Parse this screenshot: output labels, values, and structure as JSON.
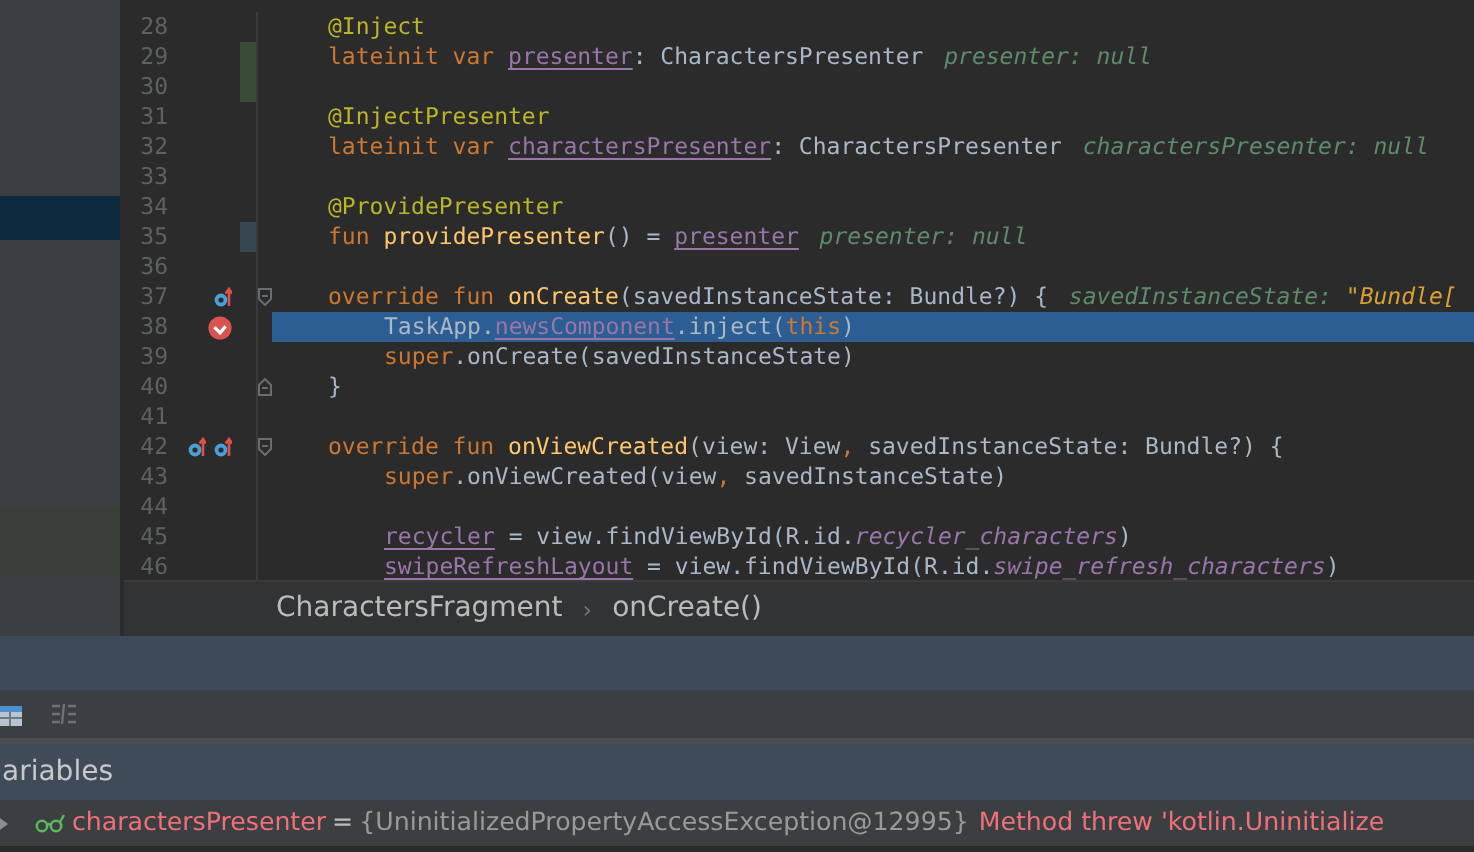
{
  "side_panel": {
    "rows": [
      {
        "selected": false
      },
      {
        "selected": false
      },
      {
        "selected": false
      },
      {
        "selected": false
      },
      {
        "selected": true
      }
    ]
  },
  "editor": {
    "lines": [
      {
        "number": "28",
        "current": false,
        "tokens": [
          {
            "kind": "ann",
            "t": "@Inject"
          }
        ]
      },
      {
        "number": "29",
        "current": false,
        "change_marker": {
          "color": "#384c38"
        },
        "tokens": [
          {
            "kind": "kw",
            "t": "lateinit var "
          },
          {
            "kind": "field",
            "t": "presenter"
          },
          {
            "kind": "plain",
            "t": ": CharactersPresenter"
          },
          {
            "kind": "hint",
            "t": "presenter: null"
          }
        ]
      },
      {
        "number": "30",
        "current": false,
        "change_marker": {
          "color": "#384c38"
        }
      },
      {
        "number": "31",
        "current": false,
        "tokens": [
          {
            "kind": "ann",
            "t": "@InjectPresenter"
          }
        ]
      },
      {
        "number": "32",
        "current": false,
        "tokens": [
          {
            "kind": "kw",
            "t": "lateinit var "
          },
          {
            "kind": "field",
            "t": "charactersPresenter"
          },
          {
            "kind": "plain",
            "t": ": CharactersPresenter"
          },
          {
            "kind": "hint",
            "t": "charactersPresenter: null"
          }
        ]
      },
      {
        "number": "33",
        "current": false
      },
      {
        "number": "34",
        "current": false,
        "tokens": [
          {
            "kind": "ann",
            "t": "@ProvidePresenter"
          }
        ]
      },
      {
        "number": "35",
        "current": false,
        "change_marker": {
          "color": "#374752"
        },
        "tokens": [
          {
            "kind": "kw",
            "t": "fun "
          },
          {
            "kind": "fn",
            "t": "providePresenter"
          },
          {
            "kind": "plain",
            "t": "() = "
          },
          {
            "kind": "field",
            "t": "presenter"
          },
          {
            "kind": "hint",
            "t": "presenter: null"
          }
        ]
      },
      {
        "number": "36",
        "current": false
      },
      {
        "number": "37",
        "current": false,
        "icons": [
          {
            "kind": "override"
          }
        ],
        "fold": {
          "kind": "start"
        },
        "tokens": [
          {
            "kind": "kw",
            "t": "override fun "
          },
          {
            "kind": "fn",
            "t": "onCreate"
          },
          {
            "kind": "plain",
            "t": "(savedInstanceState: Bundle?) {"
          },
          {
            "kind": "hint",
            "t": "savedInstanceState:"
          },
          {
            "kind": "str",
            "t": "\"Bundle["
          }
        ]
      },
      {
        "number": "38",
        "current": true,
        "indented": true,
        "icons": [
          {
            "kind": "breakpoint"
          }
        ],
        "tokens": [
          {
            "kind": "plain",
            "t": "TaskApp."
          },
          {
            "kind": "field",
            "t": "newsComponent"
          },
          {
            "kind": "plain",
            "t": ".inject("
          },
          {
            "kind": "kw",
            "t": "this"
          },
          {
            "kind": "plain",
            "t": ")"
          }
        ]
      },
      {
        "number": "39",
        "current": false,
        "indented": true,
        "tokens": [
          {
            "kind": "kw",
            "t": "super"
          },
          {
            "kind": "plain",
            "t": ".onCreate(savedInstanceState)"
          }
        ]
      },
      {
        "number": "40",
        "current": false,
        "fold": {
          "kind": "end"
        },
        "tokens": [
          {
            "kind": "plain",
            "t": "}"
          }
        ]
      },
      {
        "number": "41",
        "current": false
      },
      {
        "number": "42",
        "current": false,
        "icons": [
          {
            "kind": "override"
          },
          {
            "kind": "override"
          }
        ],
        "fold": {
          "kind": "start"
        },
        "tokens": [
          {
            "kind": "kw",
            "t": "override fun "
          },
          {
            "kind": "fn",
            "t": "onViewCreated"
          },
          {
            "kind": "plain",
            "t": "(view: View"
          },
          {
            "kind": "kw",
            "t": ","
          },
          {
            "kind": "plain",
            "t": " savedInstanceState: Bundle?) {"
          }
        ]
      },
      {
        "number": "43",
        "current": false,
        "indented": true,
        "tokens": [
          {
            "kind": "kw",
            "t": "super"
          },
          {
            "kind": "plain",
            "t": ".onViewCreated(view"
          },
          {
            "kind": "kw",
            "t": ","
          },
          {
            "kind": "plain",
            "t": " savedInstanceState)"
          }
        ]
      },
      {
        "number": "44",
        "current": false
      },
      {
        "number": "45",
        "current": false,
        "indented": true,
        "tokens": [
          {
            "kind": "field",
            "t": "recycler"
          },
          {
            "kind": "plain",
            "t": " = view.findViewById(R.id."
          },
          {
            "kind": "res",
            "t": "recycler_characters"
          },
          {
            "kind": "plain",
            "t": ")"
          }
        ]
      },
      {
        "number": "46",
        "current": false,
        "indented": true,
        "tokens": [
          {
            "kind": "field",
            "t": "swipeRefreshLayout"
          },
          {
            "kind": "plain",
            "t": " = view.findViewById(R.id."
          },
          {
            "kind": "res",
            "t": "swipe_refresh_characters"
          },
          {
            "kind": "plain",
            "t": ")"
          }
        ]
      }
    ]
  },
  "breadcrumb": [
    {
      "text": "CharactersFragment"
    },
    {
      "text": "›"
    },
    {
      "text": "onCreate()"
    }
  ],
  "variables_panel": {
    "title": "ariables",
    "rows": [
      {
        "name": "charactersPresenter",
        "equals": "=",
        "value": "{UninitializedPropertyAccessException@12995}",
        "error": "Method threw 'kotlin.Uninitialize"
      }
    ]
  }
}
